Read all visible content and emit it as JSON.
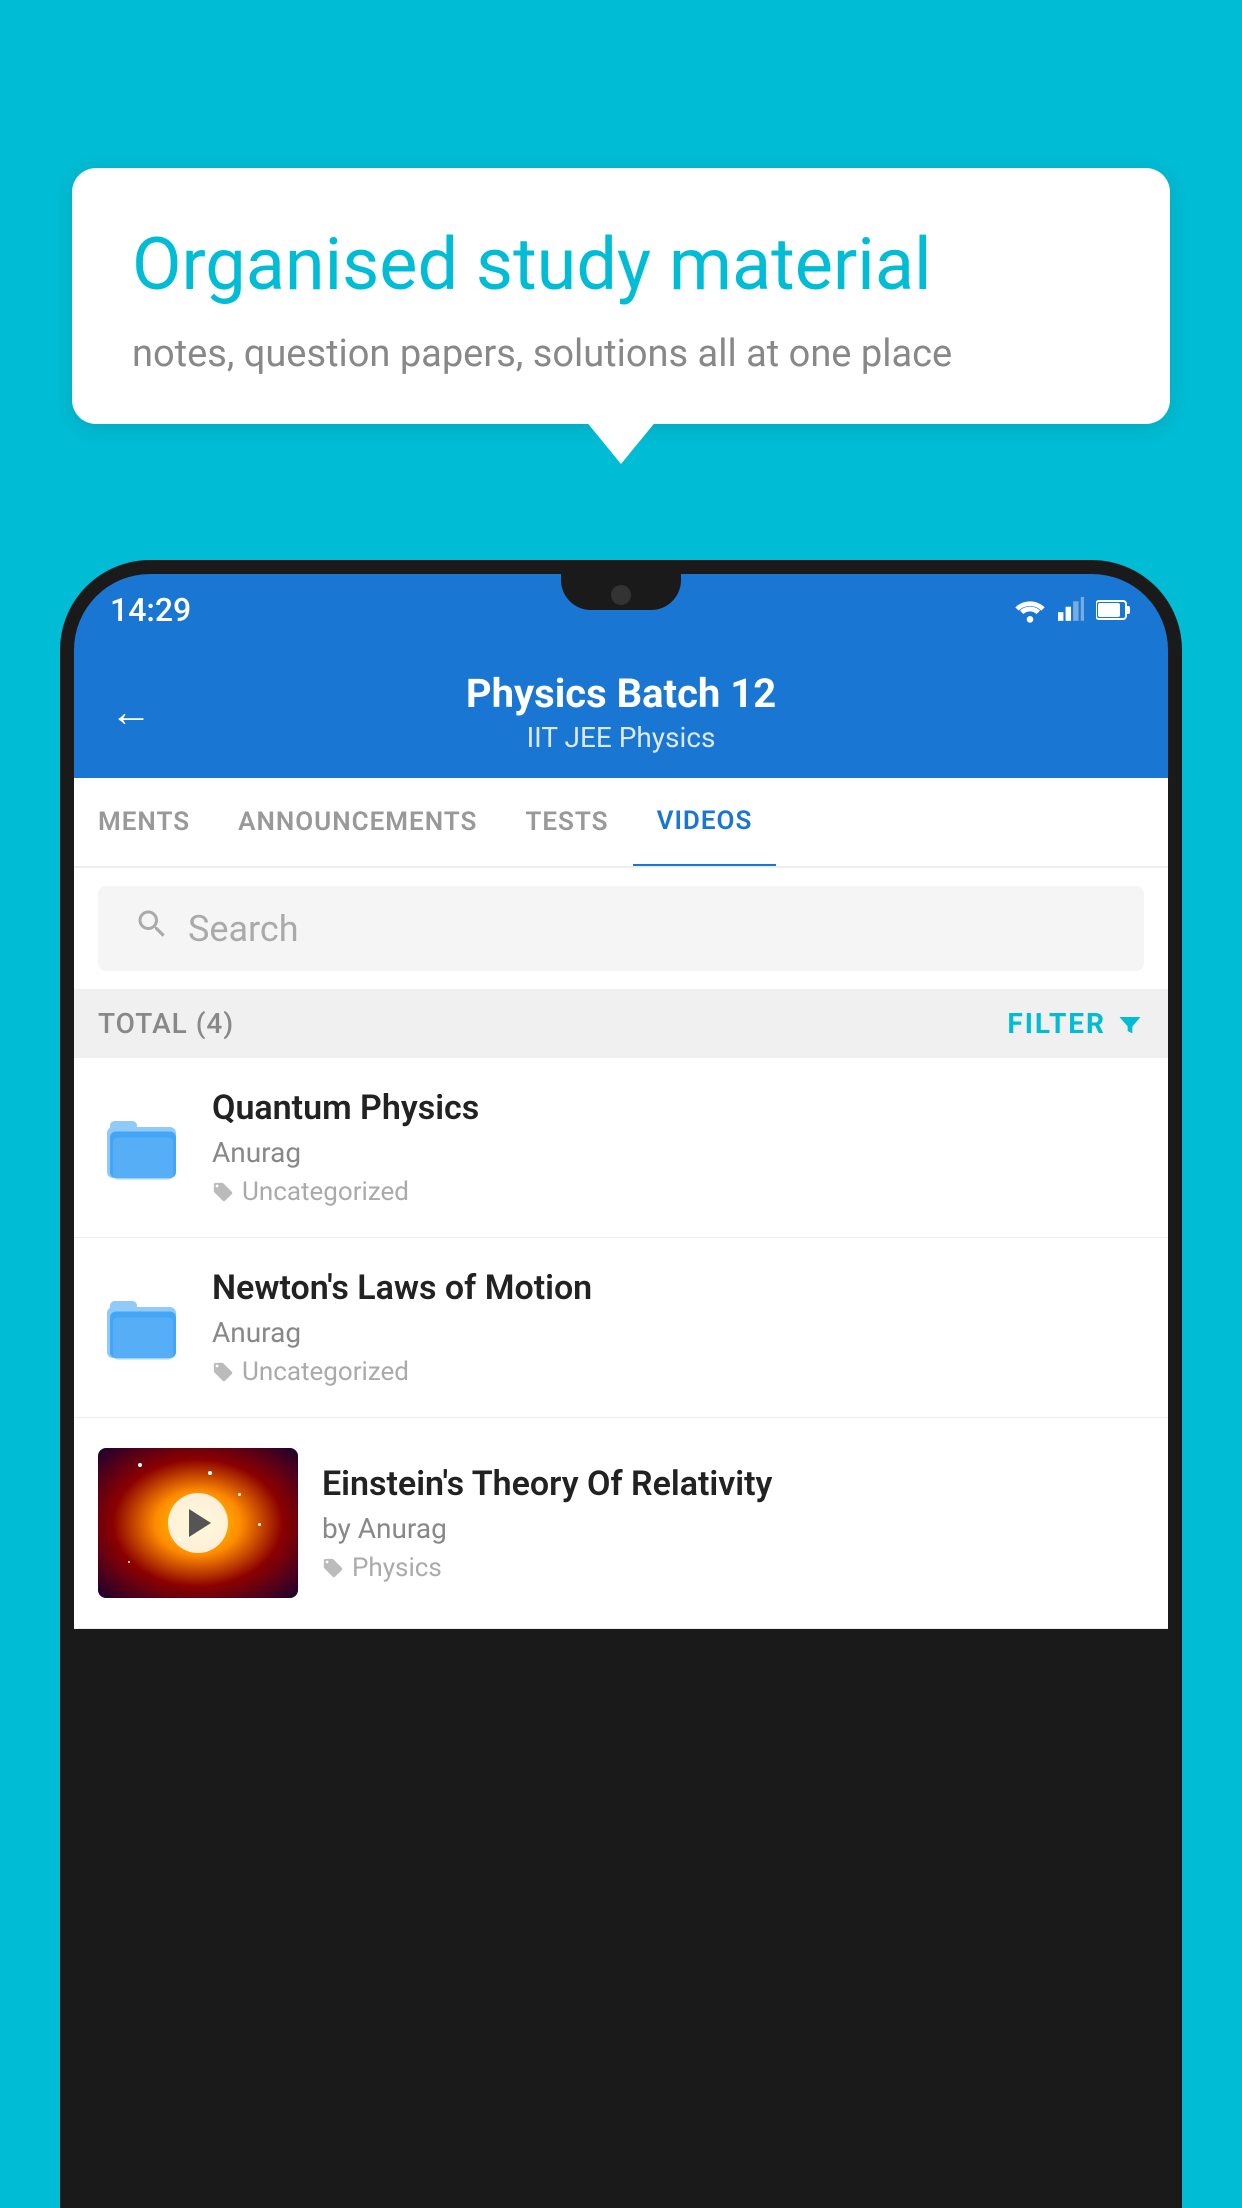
{
  "bubble": {
    "title": "Organised study material",
    "subtitle": "notes, question papers, solutions all at one place"
  },
  "statusBar": {
    "time": "14:29"
  },
  "header": {
    "title": "Physics Batch 12",
    "subtitle": "IIT JEE   Physics",
    "back_label": "←"
  },
  "tabs": [
    {
      "label": "MENTS",
      "active": false
    },
    {
      "label": "ANNOUNCEMENTS",
      "active": false
    },
    {
      "label": "TESTS",
      "active": false
    },
    {
      "label": "VIDEOS",
      "active": true
    }
  ],
  "search": {
    "placeholder": "Search"
  },
  "filterRow": {
    "total": "TOTAL (4)",
    "filter": "FILTER"
  },
  "videos": [
    {
      "title": "Quantum Physics",
      "author": "Anurag",
      "tag": "Uncategorized",
      "hasThumb": false
    },
    {
      "title": "Newton's Laws of Motion",
      "author": "Anurag",
      "tag": "Uncategorized",
      "hasThumb": false
    },
    {
      "title": "Einstein's Theory Of Relativity",
      "author": "by Anurag",
      "tag": "Physics",
      "hasThumb": true
    }
  ]
}
